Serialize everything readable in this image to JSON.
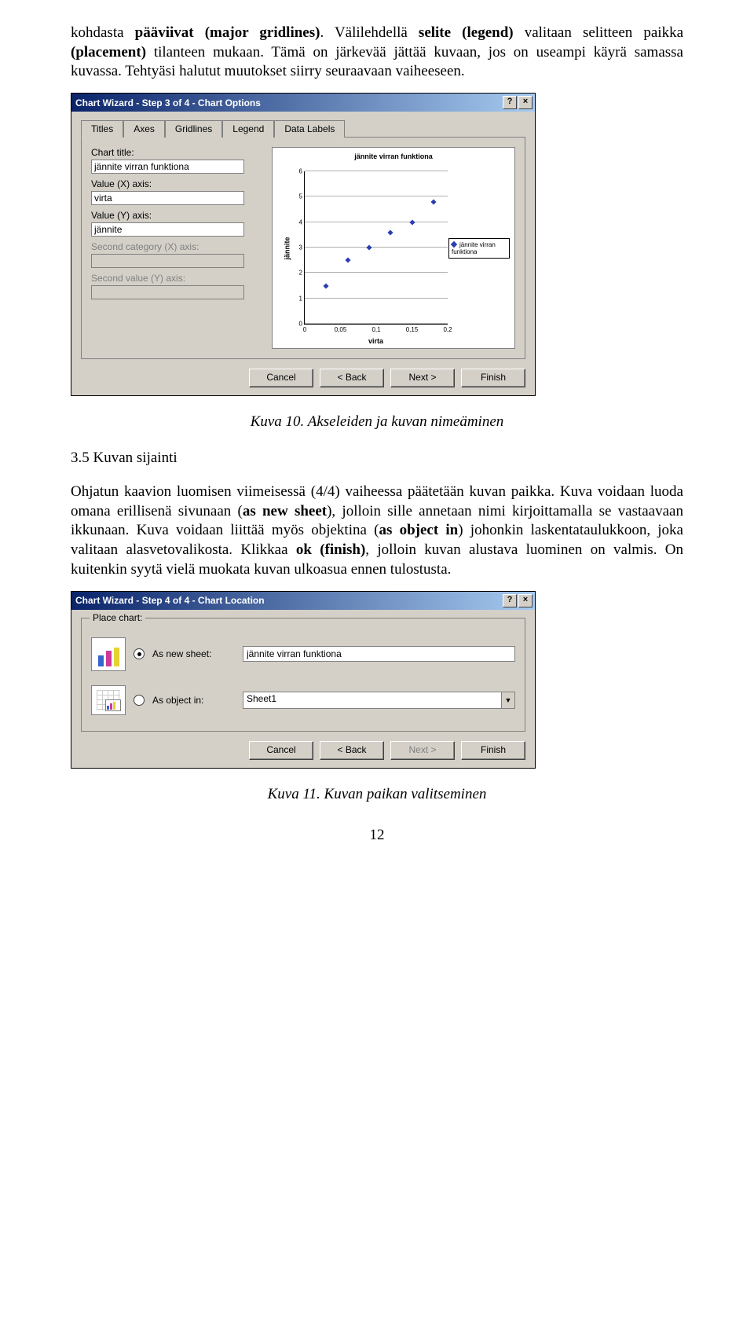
{
  "para1_pre": "kohdasta ",
  "para1_b1": "pääviivat (major gridlines)",
  "para1_mid1": ". Välilehdellä ",
  "para1_b2": "selite (legend)",
  "para1_mid2": " valitaan selitteen paikka ",
  "para1_b3": "(placement)",
  "para1_post": " tilanteen mukaan. Tämä on järkevää jättää kuvaan, jos on useampi käyrä samassa kuvassa. Tehtyäsi halutut muutokset siirry seuraavaan vaiheeseen.",
  "dlg1": {
    "title": "Chart Wizard - Step 3 of 4 - Chart Options",
    "tabs": [
      "Titles",
      "Axes",
      "Gridlines",
      "Legend",
      "Data Labels"
    ],
    "labels": {
      "chart_title": "Chart title:",
      "x_axis": "Value (X) axis:",
      "y_axis": "Value (Y) axis:",
      "sec_x": "Second category (X) axis:",
      "sec_y": "Second value (Y) axis:"
    },
    "values": {
      "chart_title": "jännite virran funktiona",
      "x_axis": "virta",
      "y_axis": "jännite"
    },
    "preview": {
      "title": "jännite virran funktiona",
      "ylabel": "jännite",
      "xlabel": "virta",
      "legend": "jännite virran funktiona"
    },
    "buttons": {
      "cancel": "Cancel",
      "back": "< Back",
      "next": "Next >",
      "finish": "Finish"
    }
  },
  "caption1": "Kuva 10. Akseleiden ja kuvan nimeäminen",
  "heading": "3.5   Kuvan sijainti",
  "para2_a": "Ohjatun kaavion luomisen viimeisessä (4/4) vaiheessa päätetään kuvan paikka. Kuva voidaan luoda omana erillisenä sivunaan (",
  "para2_b1": "as new sheet",
  "para2_b": "), jolloin sille annetaan nimi kirjoittamalla se vastaavaan ikkunaan. Kuva voidaan liittää myös objektina (",
  "para2_b2": "as object in",
  "para2_c": ") johonkin laskentataulukkoon, joka valitaan alasvetovalikosta. Klikkaa ",
  "para2_b3": "ok (finish)",
  "para2_d": ", jolloin kuvan alustava luominen on valmis. On kuitenkin syytä vielä muokata kuvan ulkoasua ennen tulostusta.",
  "dlg2": {
    "title": "Chart Wizard - Step 4 of 4 - Chart Location",
    "group": "Place chart:",
    "opt_new": "As new sheet:",
    "opt_obj": "As object in:",
    "new_value": "jännite virran funktiona",
    "obj_value": "Sheet1",
    "buttons": {
      "cancel": "Cancel",
      "back": "< Back",
      "next": "Next >",
      "finish": "Finish"
    }
  },
  "caption2": "Kuva 11. Kuvan paikan valitseminen",
  "page_number": "12",
  "chart_data": {
    "type": "scatter",
    "title": "jännite virran funktiona",
    "xlabel": "virta",
    "ylabel": "jännite",
    "xlim": [
      0,
      0.2
    ],
    "ylim": [
      0,
      6
    ],
    "xticks": [
      0,
      0.05,
      0.1,
      0.15,
      0.2
    ],
    "yticks": [
      0,
      1,
      2,
      3,
      4,
      5,
      6
    ],
    "series": [
      {
        "name": "jännite virran funktiona",
        "x": [
          0.03,
          0.06,
          0.09,
          0.12,
          0.15,
          0.18
        ],
        "y": [
          1.5,
          2.5,
          3.0,
          3.6,
          4.0,
          4.8
        ]
      }
    ]
  }
}
